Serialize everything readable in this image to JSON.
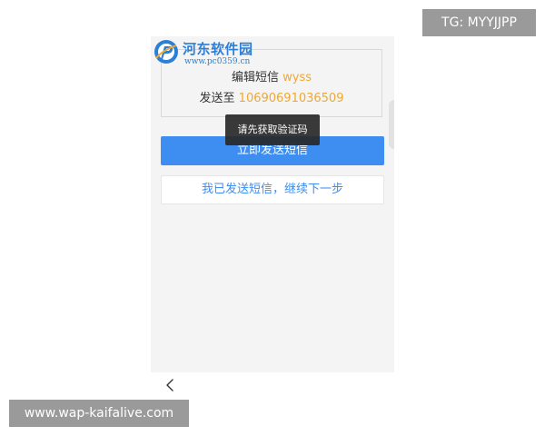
{
  "watermark": {
    "logo_name": "河东软件园",
    "logo_url": "www.pc0359.cn",
    "logo_icon": "pc-logo-icon"
  },
  "sms": {
    "edit_prefix": "编辑短信",
    "keyword": "wyss",
    "send_to_prefix": "发送至",
    "number": "10690691036509"
  },
  "buttons": {
    "send_now": "立即发送短信",
    "sent_next": "我已发送短信，继续下一步"
  },
  "toast": {
    "message": "请先获取验证码"
  },
  "navigation": {
    "back_icon": "chevron-left-icon"
  },
  "overlays": {
    "tg_label": "TG: MYYJJPP",
    "site_label": "www.wap-kaifalive.com"
  },
  "colors": {
    "primary": "#3d8ef0",
    "highlight": "#f0a830",
    "toast_bg": "#282828",
    "screen_bg": "#f4f4f4"
  }
}
